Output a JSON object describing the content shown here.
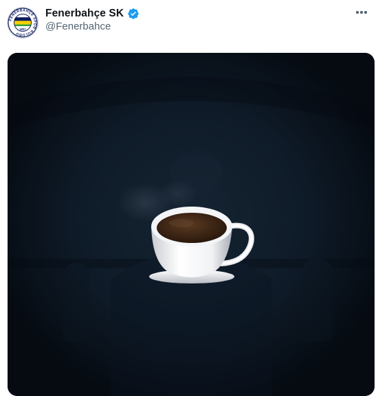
{
  "tweet": {
    "author": {
      "display_name": "Fenerbahçe SK",
      "handle": "@Fenerbahce",
      "verified": true,
      "avatar_icon": "fenerbahce-crest-icon",
      "avatar_text": "FENERBAHÇE SPOR KULÜBÜ",
      "avatar_year": "1907"
    },
    "more_icon": "more-horizontal-icon",
    "media": {
      "type": "video-frame",
      "content_icon": "coffee-cup-icon"
    }
  },
  "colors": {
    "name_text": "#0f1419",
    "secondary_text": "#536471",
    "verified_blue": "#1d9bf0",
    "media_bg": "#0a111b",
    "crest_navy": "#0d1b5e",
    "crest_yellow": "#f5d000"
  }
}
